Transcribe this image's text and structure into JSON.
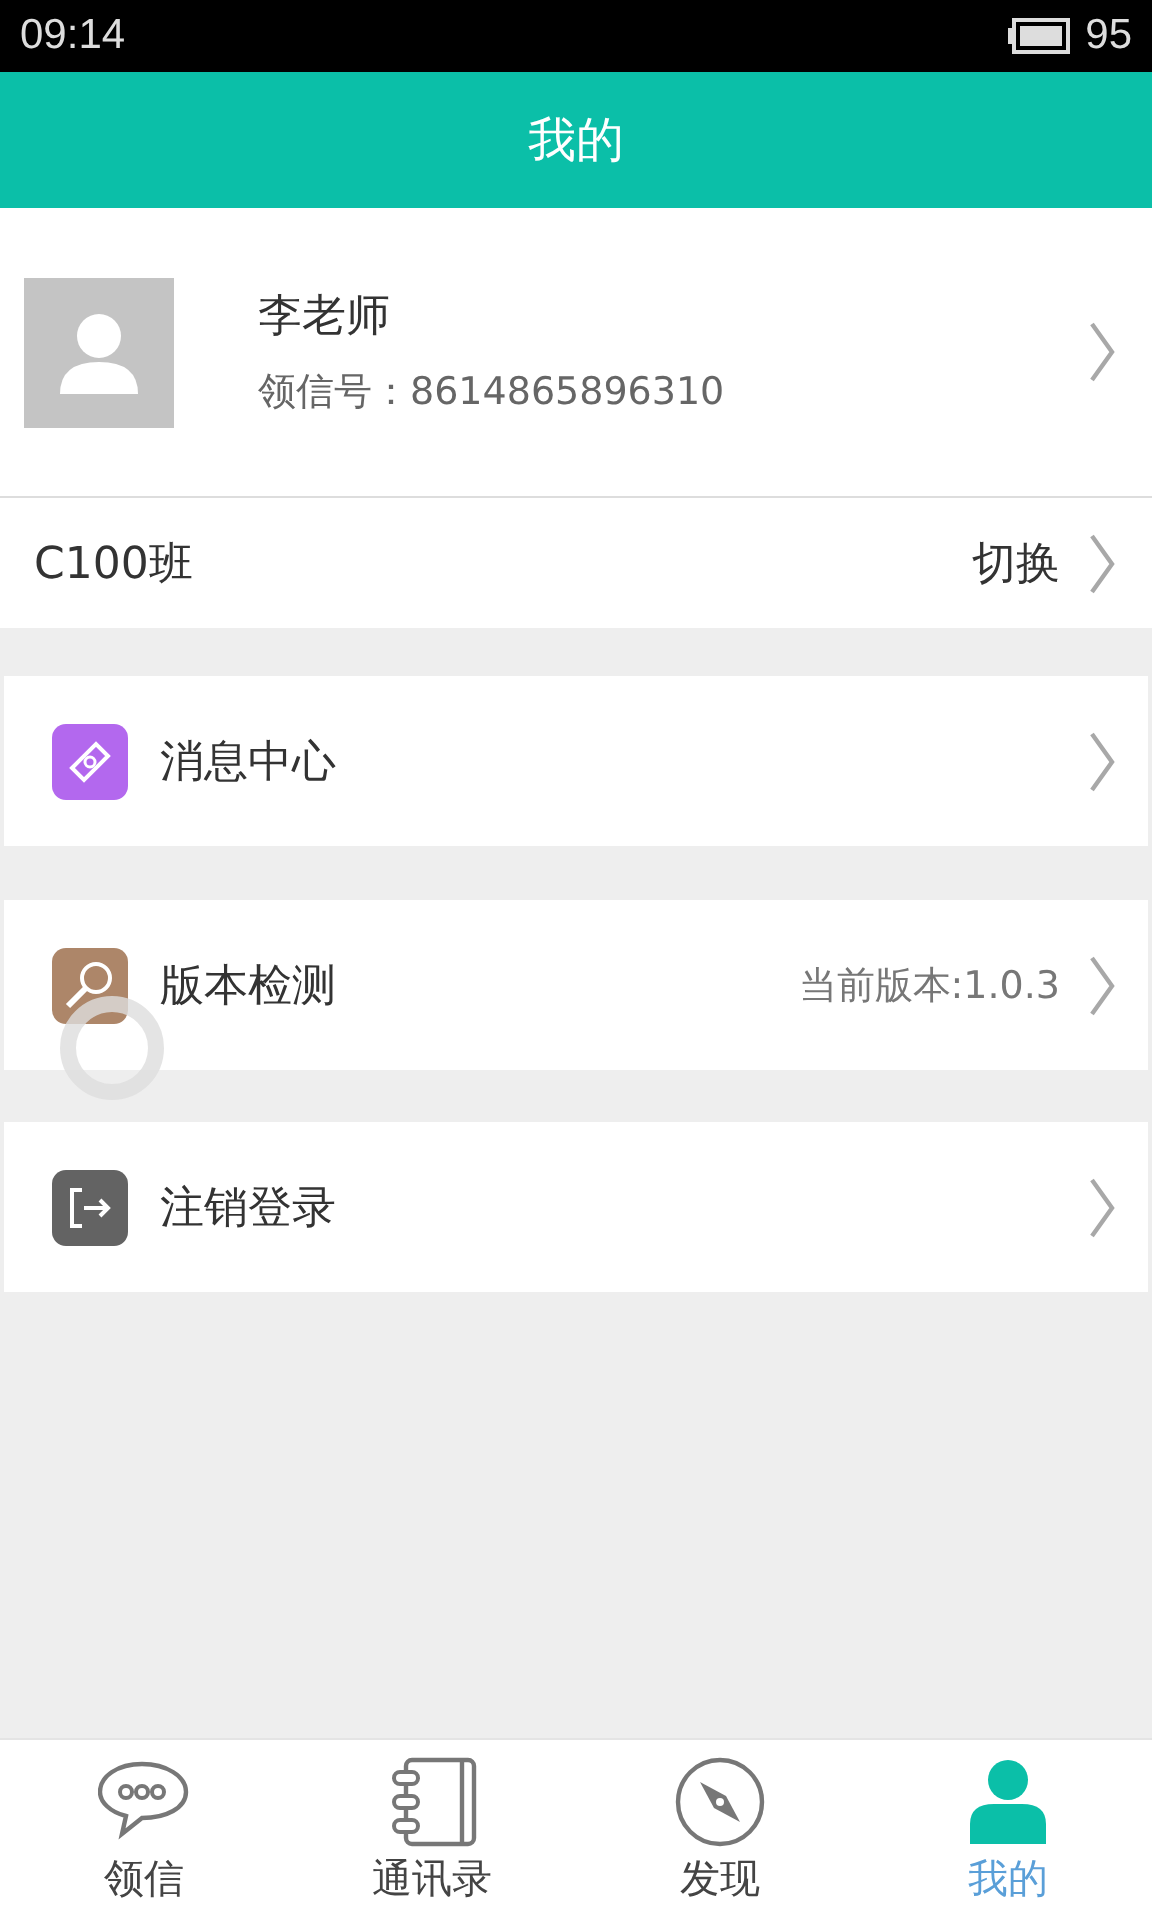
{
  "status_bar": {
    "time": "09:14",
    "battery": "95"
  },
  "header": {
    "title": "我的"
  },
  "profile": {
    "name": "李老师",
    "id_label": "领信号：8614865896310"
  },
  "class_row": {
    "label": "C100班",
    "action": "切换"
  },
  "menu": [
    {
      "kind": "message",
      "label": "消息中心",
      "color": "#b368ee"
    },
    {
      "kind": "version",
      "label": "版本检测",
      "value": "当前版本:1.0.3",
      "color": "#ad8669"
    },
    {
      "kind": "logout",
      "label": "注销登录",
      "color": "#636363"
    }
  ],
  "loading": true,
  "tabs": [
    {
      "kind": "chat",
      "label": "领信",
      "selected": false
    },
    {
      "kind": "contacts",
      "label": "通讯录",
      "selected": false
    },
    {
      "kind": "discover",
      "label": "发现",
      "selected": false
    },
    {
      "kind": "me",
      "label": "我的",
      "selected": true
    }
  ]
}
